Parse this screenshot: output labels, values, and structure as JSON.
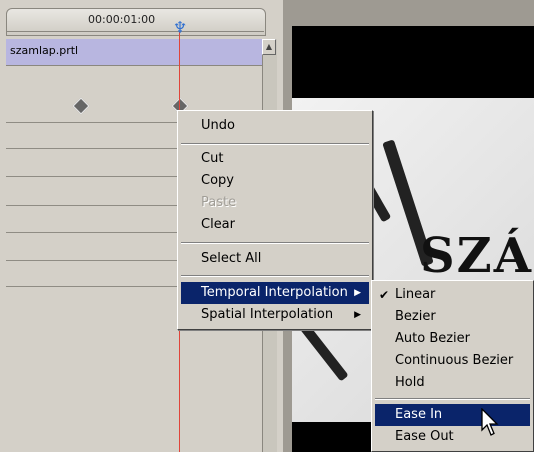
{
  "timeline": {
    "timecode": "00:00:01:00",
    "clip_name": "szamlap.prtl"
  },
  "context_menu": {
    "items": [
      {
        "label": "Undo",
        "enabled": true
      },
      {
        "label": "Cut",
        "enabled": true
      },
      {
        "label": "Copy",
        "enabled": true
      },
      {
        "label": "Paste",
        "enabled": false
      },
      {
        "label": "Clear",
        "enabled": true
      },
      {
        "label": "Select All",
        "enabled": true
      },
      {
        "label": "Temporal Interpolation",
        "enabled": true,
        "submenu": true,
        "highlighted": true
      },
      {
        "label": "Spatial Interpolation",
        "enabled": true,
        "submenu": true
      }
    ]
  },
  "submenu": {
    "items": [
      {
        "label": "Linear",
        "checked": true
      },
      {
        "label": "Bezier"
      },
      {
        "label": "Auto Bezier"
      },
      {
        "label": "Continuous Bezier"
      },
      {
        "label": "Hold"
      },
      {
        "label": "Ease In",
        "highlighted": true
      },
      {
        "label": "Ease Out"
      }
    ]
  },
  "preview": {
    "title_text": "SZÁ"
  },
  "icons": {
    "submenu_arrow": "▶",
    "check": "✔",
    "scroll_up": "▲",
    "playhead": "♆"
  },
  "colors": {
    "highlight": "#0a246a",
    "playhead": "#e0453a",
    "clip_row": "#b8b6e0"
  }
}
